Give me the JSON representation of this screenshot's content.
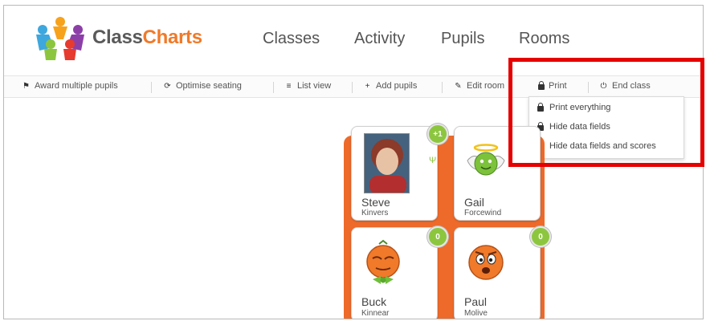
{
  "brand": {
    "part1": "Class",
    "part2": "Charts"
  },
  "nav": {
    "items": [
      "Classes",
      "Activity",
      "Pupils",
      "Rooms"
    ]
  },
  "toolbar": {
    "award": "Award multiple pupils",
    "optimise": "Optimise seating",
    "listview": "List view",
    "add": "Add pupils",
    "edit": "Edit room",
    "print": "Print",
    "end": "End class"
  },
  "print_menu": {
    "items": [
      "Print everything",
      "Hide data fields",
      "Hide data fields and scores"
    ]
  },
  "pupils": [
    {
      "first": "Steve",
      "last": "Kinvers",
      "score": "+1"
    },
    {
      "first": "Gail",
      "last": "Forcewind",
      "score": ""
    },
    {
      "first": "Buck",
      "last": "Kinnear",
      "score": "0"
    },
    {
      "first": "Paul",
      "last": "Molive",
      "score": "0"
    }
  ],
  "colors": {
    "accent": "#f07a2a",
    "badge": "#8cc63f",
    "highlight": "#e60000"
  }
}
